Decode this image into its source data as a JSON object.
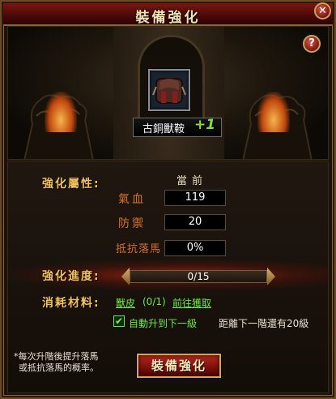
{
  "window": {
    "title": "裝備強化",
    "close_symbol": "✕"
  },
  "help": {
    "symbol": "?"
  },
  "item": {
    "name": "古銅獸鞍",
    "level": "+1"
  },
  "stats": {
    "section_label": "強化屬性:",
    "column_header": "當前",
    "rows": [
      {
        "label": "氣血",
        "value": "119"
      },
      {
        "label": "防禦",
        "value": "20"
      },
      {
        "label": "抵抗落馬",
        "value": "0%"
      }
    ]
  },
  "progress": {
    "label": "強化進度:",
    "text": "0/15",
    "current": 0,
    "max": 15
  },
  "materials": {
    "label": "消耗材料:",
    "item_link": "獸皮",
    "count": "(0/1)",
    "obtain_link": "前往獲取"
  },
  "auto_upgrade": {
    "label": "自動升到下一級",
    "checked": true,
    "check_symbol": "✔"
  },
  "next_tier_text": "距離下一階還有20級",
  "note": {
    "line1": "*每次升階後提升落馬",
    "line2": "或抵抗落馬的概率。"
  },
  "action_button": "裝備強化",
  "colors": {
    "accent_gold": "#f2c35b",
    "green": "#6ee845",
    "title_red": "#7a1712"
  }
}
